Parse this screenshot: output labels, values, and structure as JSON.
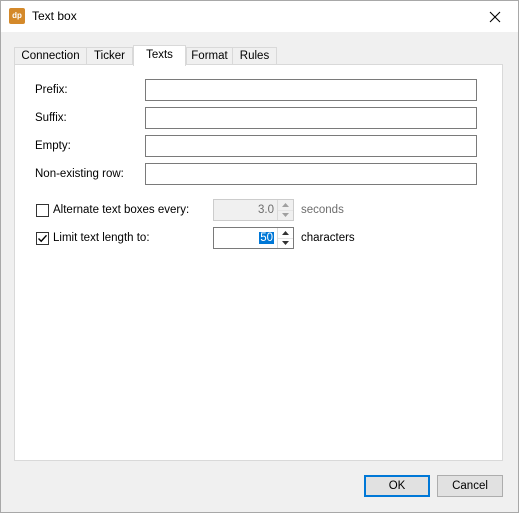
{
  "window": {
    "title": "Text box",
    "app_icon_text": "dp",
    "app_icon_color": "#d4892a",
    "close_icon": "close-icon"
  },
  "tabs": [
    {
      "label": "Connection",
      "active": false
    },
    {
      "label": "Ticker",
      "active": false
    },
    {
      "label": "Texts",
      "active": true
    },
    {
      "label": "Format",
      "active": false
    },
    {
      "label": "Rules",
      "active": false
    }
  ],
  "fields": {
    "prefix": {
      "label": "Prefix:",
      "value": ""
    },
    "suffix": {
      "label": "Suffix:",
      "value": ""
    },
    "empty": {
      "label": "Empty:",
      "value": ""
    },
    "non_existing_row": {
      "label": "Non-existing row:",
      "value": ""
    }
  },
  "alternate": {
    "label": "Alternate text boxes every:",
    "checked": false,
    "value": "3.0",
    "unit": "seconds",
    "enabled": false
  },
  "limit": {
    "label": "Limit text length to:",
    "checked": true,
    "value": "50",
    "unit": "characters",
    "enabled": true
  },
  "buttons": {
    "ok": "OK",
    "cancel": "Cancel"
  },
  "colors": {
    "accent": "#0078d7"
  }
}
